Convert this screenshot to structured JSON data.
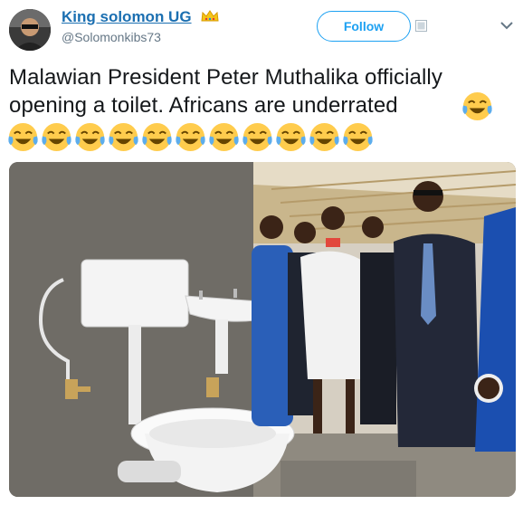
{
  "author": {
    "display_name": "King solomon UG",
    "handle": "@Solomonkibs73",
    "badge_icon": "crown-emoji-icon",
    "avatar_icon": "profile-photo"
  },
  "actions": {
    "follow_label": "Follow",
    "add_icon": "add-to-list-icon",
    "menu_icon": "chevron-down-icon"
  },
  "tweet": {
    "text": "Malawian President Peter Muthalika officially opening a toilet. Africans are underrated",
    "trailing_emoji": "face-with-tears-of-joy",
    "emoji_row_count": 11
  },
  "media": {
    "image_icon": "photo-toilet-inauguration"
  },
  "colors": {
    "link": "#1b6fb1",
    "follow": "#1da1f2",
    "handle": "#657786",
    "text": "#14171a"
  }
}
